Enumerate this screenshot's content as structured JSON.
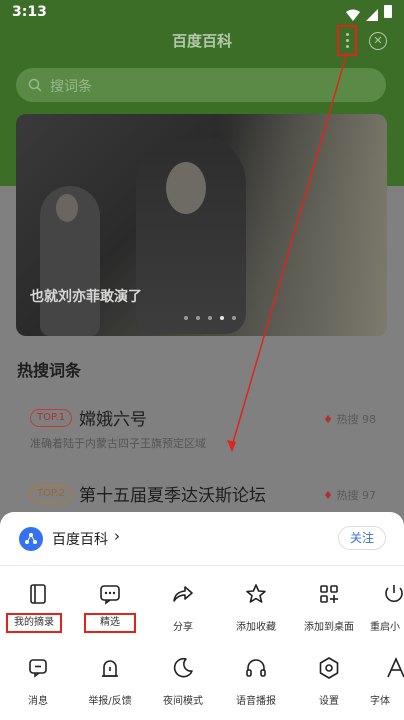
{
  "status_bar": {
    "time": "3:13"
  },
  "header": {
    "title": "百度百科"
  },
  "search": {
    "placeholder": "搜词条"
  },
  "banner": {
    "caption": "也就刘亦菲敢演了",
    "dot_count": 5,
    "active_dot": 4
  },
  "hot": {
    "section_title": "热搜词条",
    "items": [
      {
        "badge": "TOP.1",
        "title": "嫦娥六号",
        "heat": "热搜 98",
        "desc": "准确着陆于内蒙古四子王旗预定区域"
      },
      {
        "badge": "TOP.2",
        "title": "第十五届夏季达沃斯论坛",
        "heat": "热搜 97"
      }
    ]
  },
  "sheet": {
    "app_name": "百度百科",
    "app_chevron": "›",
    "follow_label": "关注",
    "row1": [
      {
        "label": "我的摘录",
        "icon": "notebook-icon"
      },
      {
        "label": "精选",
        "icon": "message-dots-icon"
      },
      {
        "label": "分享",
        "icon": "share-icon"
      },
      {
        "label": "添加收藏",
        "icon": "star-icon"
      },
      {
        "label": "添加到桌面",
        "icon": "grid-add-icon"
      },
      {
        "label": "重启小",
        "icon": "restart-icon"
      }
    ],
    "row2": [
      {
        "label": "消息",
        "icon": "chat-icon"
      },
      {
        "label": "举报/反馈",
        "icon": "alert-person-icon"
      },
      {
        "label": "夜间模式",
        "icon": "moon-icon"
      },
      {
        "label": "语音播报",
        "icon": "headphones-icon"
      },
      {
        "label": "设置",
        "icon": "settings-icon"
      },
      {
        "label": "字体",
        "icon": "font-icon"
      }
    ]
  },
  "colors": {
    "annotation_red": "#e0241c",
    "follow_blue": "#3a6fe0",
    "brand_green": "#4caf28"
  }
}
